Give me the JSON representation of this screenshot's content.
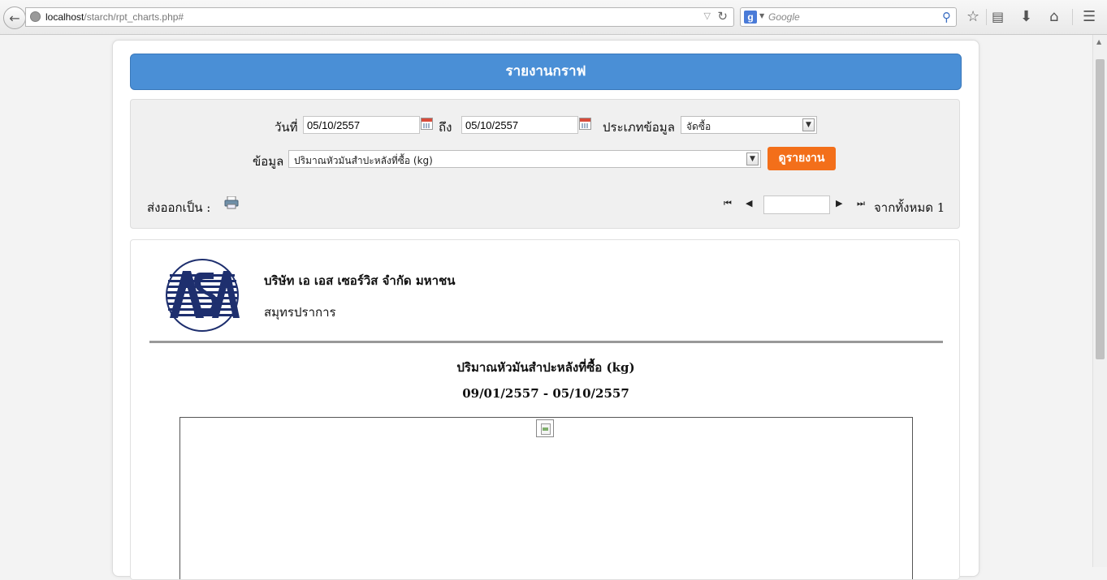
{
  "browser": {
    "url_host": "localhost",
    "url_path": "/starch/rpt_charts.php#",
    "search_placeholder": "Google",
    "icons": [
      "back-icon",
      "globe-icon",
      "reload-icon",
      "google-icon",
      "search-icon",
      "star-icon",
      "reading-list-icon",
      "download-icon",
      "home-icon",
      "menu-icon"
    ]
  },
  "header": {
    "title": "รายงานกราฟ"
  },
  "filters": {
    "date_label": "วันที่",
    "date_from": "05/10/2557",
    "to_label": "ถึง",
    "date_to": "05/10/2557",
    "type_label": "ประเภทข้อมูล",
    "type_value": "จัดซื้อ",
    "data_label": "ข้อมูล",
    "data_value": "ปริมาณหัวมันสำปะหลังที่ซื้อ (kg)",
    "view_button": "ดูรายงาน",
    "export_label": "ส่งออกเป็น :",
    "page_total": "จากทั้งหมด 1",
    "page_value": ""
  },
  "report": {
    "company": "บริษัท เอ เอส เซอร์วิส จำกัด มหาชน",
    "province": "สมุทรปราการ",
    "title": "ปริมาณหัวมันสำปะหลังที่ซื้อ (kg)",
    "range": "09/01/2557 - 05/10/2557"
  },
  "colors": {
    "accent": "#4a8fd6",
    "button": "#f36f1a",
    "logo": "#1e2f6e"
  }
}
